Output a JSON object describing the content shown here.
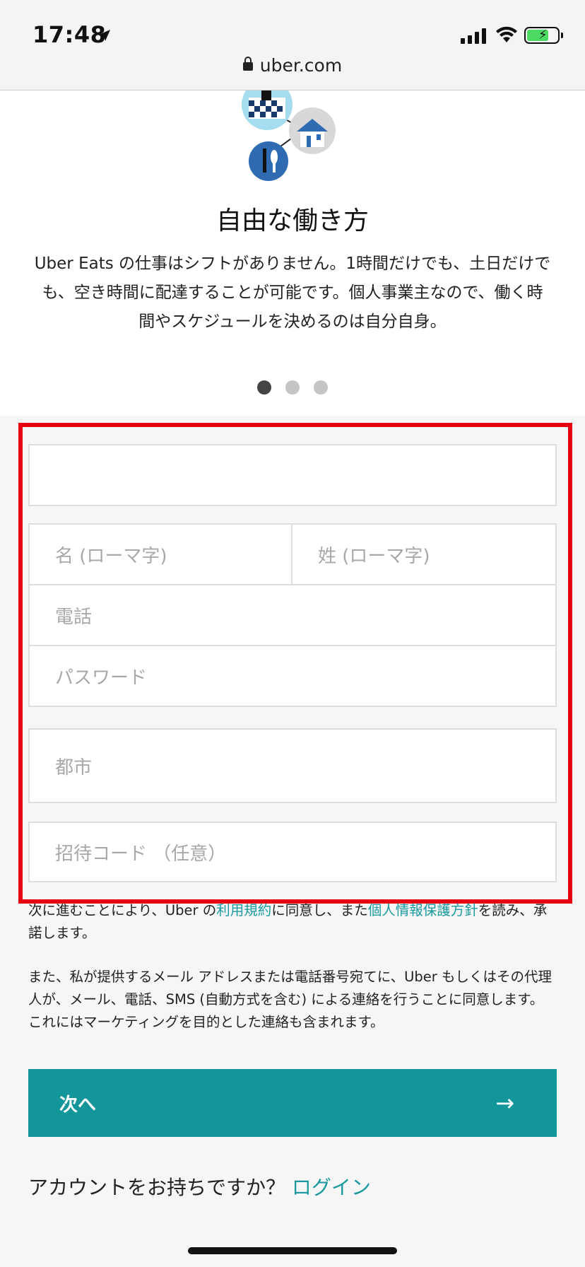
{
  "status_bar": {
    "time": "17:48",
    "icons": [
      "location-arrow-icon",
      "signal-icon",
      "wifi-icon",
      "battery-charging-icon"
    ],
    "battery_color": "#4cd964"
  },
  "url_bar": {
    "domain": "uber.com",
    "icon": "lock-icon"
  },
  "hero": {
    "title": "自由な働き方",
    "text": "Uber Eats の仕事はシフトがありません。1時間だけでも、土日だけでも、空き時間に配達することが可能です。個人事業主なので、働く時間やスケジュールを決めるのは自分自身。",
    "carousel": {
      "pages": 3,
      "active_index": 0
    }
  },
  "form": {
    "highlight_color": "#e60012",
    "email": {
      "placeholder": "",
      "value": ""
    },
    "first_name": {
      "placeholder": "名 (ローマ字)"
    },
    "last_name": {
      "placeholder": "姓 (ローマ字)"
    },
    "phone": {
      "placeholder": "電話"
    },
    "password": {
      "placeholder": "パスワード"
    },
    "city": {
      "placeholder": "都市"
    },
    "invite_code": {
      "placeholder": "招待コード （任意）"
    }
  },
  "legal": {
    "p1_before": "次に進むことにより、Uber の",
    "terms_link": "利用規約",
    "p1_middle": "に同意し、また",
    "privacy_link": "個人情報保護方針",
    "p1_after": "を読み、承諾します。",
    "p2": "また、私が提供するメール アドレスまたは電話番号宛てに、Uber もしくはその代理人が、メール、電話、SMS (自動方式を含む) による連絡を行うことに同意します。これにはマーケティングを目的とした連絡も含まれます。"
  },
  "next_button": {
    "label": "次へ",
    "arrow": "→",
    "color": "#13969a"
  },
  "login": {
    "prompt": "アカウントをお持ちですか？",
    "link": "ログイン",
    "link_color": "#1a9aa0"
  }
}
